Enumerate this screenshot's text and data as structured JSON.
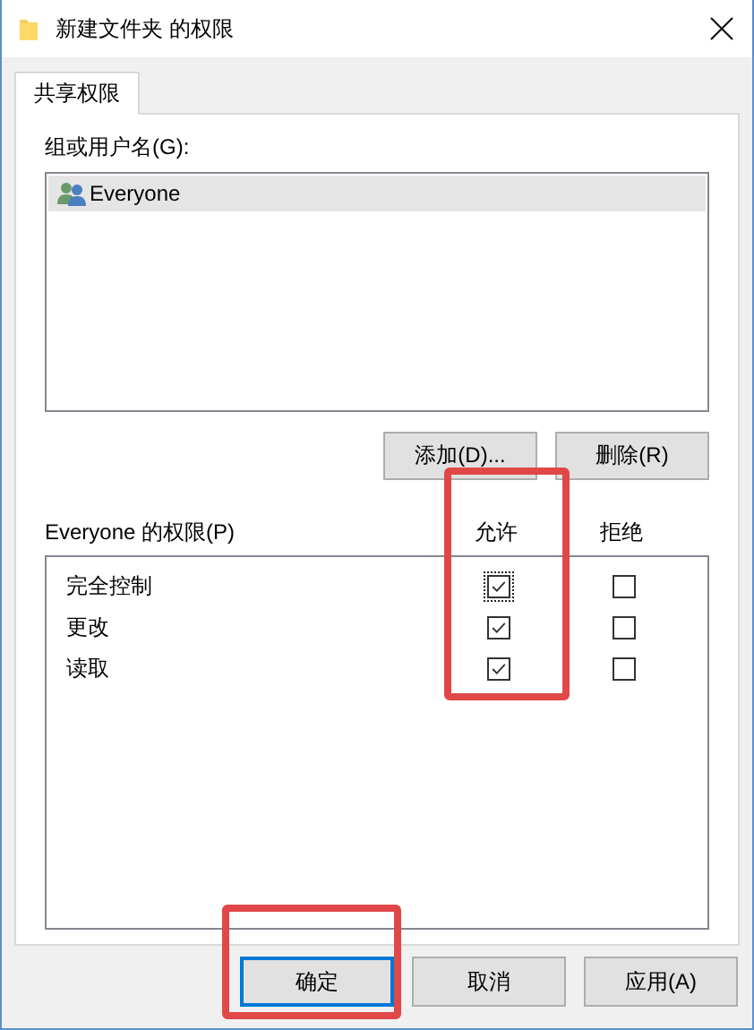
{
  "window": {
    "title": "新建文件夹 的权限"
  },
  "tabs": [
    {
      "label": "共享权限",
      "selected": true
    }
  ],
  "users": {
    "label": "组或用户名(G):",
    "items": [
      {
        "name": "Everyone",
        "selected": true
      }
    ]
  },
  "user_buttons": [
    "添加(D)...",
    "删除(R)"
  ],
  "permissions": {
    "label": "Everyone 的权限(P)",
    "columns": [
      {
        "label": "允许",
        "highlighted": true
      },
      {
        "label": "拒绝",
        "highlighted": false
      }
    ],
    "rows": [
      {
        "name": "完全控制",
        "allow": true,
        "deny": false,
        "focused": true
      },
      {
        "name": "更改",
        "allow": true,
        "deny": false,
        "focused": false
      },
      {
        "name": "读取",
        "allow": true,
        "deny": false,
        "focused": false
      }
    ]
  },
  "footer_buttons": [
    {
      "label": "确定",
      "default": true,
      "highlighted": true
    },
    {
      "label": "取消",
      "default": false,
      "highlighted": false
    },
    {
      "label": "应用(A)",
      "default": false,
      "highlighted": false
    }
  ]
}
